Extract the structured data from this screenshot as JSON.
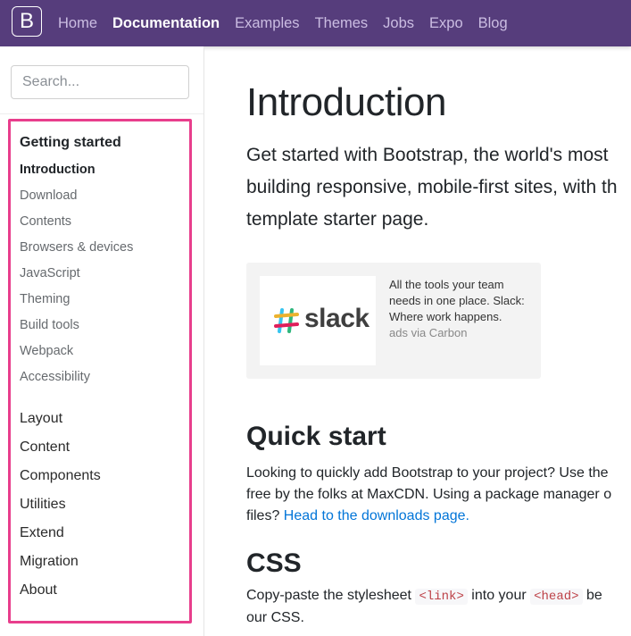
{
  "navbar": {
    "brand": "B",
    "links": [
      "Home",
      "Documentation",
      "Examples",
      "Themes",
      "Jobs",
      "Expo",
      "Blog"
    ],
    "active": "Documentation"
  },
  "sidebar": {
    "search_placeholder": "Search...",
    "groups": [
      "Getting started",
      "Layout",
      "Content",
      "Components",
      "Utilities",
      "Extend",
      "Migration",
      "About"
    ],
    "getting_started_items": [
      "Introduction",
      "Download",
      "Contents",
      "Browsers & devices",
      "JavaScript",
      "Theming",
      "Build tools",
      "Webpack",
      "Accessibility"
    ],
    "active_item": "Introduction"
  },
  "main": {
    "title": "Introduction",
    "lead": [
      "Get started with Bootstrap, the world's most",
      "building responsive, mobile-first sites, with th",
      "template starter page."
    ],
    "ad": {
      "logo_text": "slack",
      "text": "All the tools your team needs in one place. Slack: Where work happens.",
      "via": "ads via Carbon"
    },
    "quick_start": {
      "heading": "Quick start",
      "line1": "Looking to quickly add Bootstrap to your project? Use the",
      "line2": "free by the folks at MaxCDN. Using a package manager o",
      "line3_prefix": "files? ",
      "line3_link": "Head to the downloads page."
    },
    "css": {
      "heading": "CSS",
      "line1_a": "Copy-paste the stylesheet ",
      "code1": "<link>",
      "line1_b": " into your ",
      "code2": "<head>",
      "line1_c": " be",
      "line2": "our CSS."
    }
  },
  "colors": {
    "navbar_bg": "#563d7c",
    "highlight_border": "#e83e8c",
    "link": "#0275d8"
  }
}
